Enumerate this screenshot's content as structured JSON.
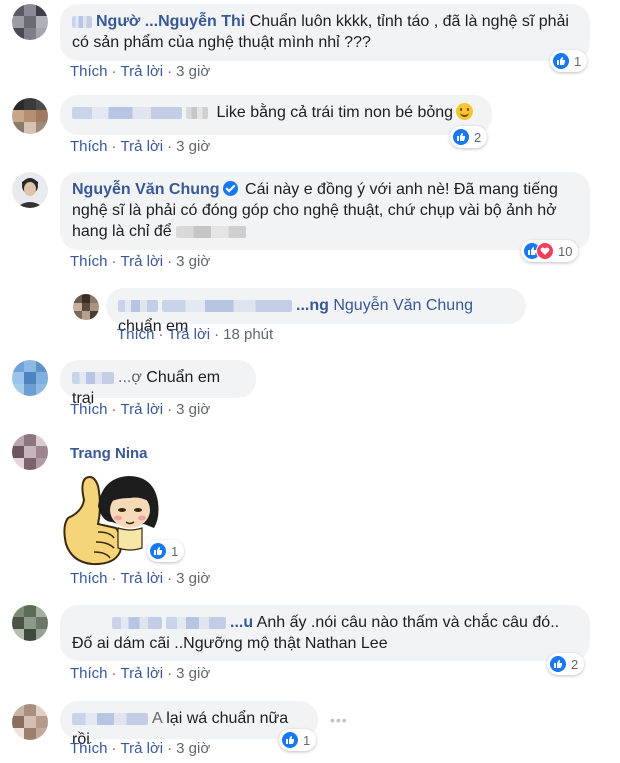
{
  "actions": {
    "like": "Thích",
    "reply": "Trả lời"
  },
  "colors": {
    "link": "#385898",
    "bubble": "#f2f3f5",
    "like": "#1877f2",
    "love": "#f33e58"
  },
  "comments": [
    {
      "author_partial": "Ngườ  ...Nguyễn Thi",
      "text": "Chuẩn luôn kkkk, tỉnh táo , đã là nghệ sĩ phải có sản phẩm của nghệ thuật mình nhỉ ???",
      "time": "3 giờ",
      "reactions": "1"
    },
    {
      "author_partial": "",
      "text": "Like bằng cả trái tim non bé bỏng",
      "time": "3 giờ",
      "reactions": "2"
    },
    {
      "author": "Nguyễn Văn Chung",
      "text": "Cái này e đồng ý với anh nè! Đã mang tiếng nghệ sĩ là phải có đóng góp cho nghệ thuật, chứ chụp vài bộ ảnh hở hang là chỉ để",
      "time": "3 giờ",
      "reactions": "10"
    },
    {
      "author_partial": "...ng",
      "mention": "Nguyễn Văn Chung",
      "text": "chuẩn em",
      "time": "18 phút"
    },
    {
      "author_partial": "...ợ",
      "text": "Chuẩn em trai",
      "time": "3 giờ"
    },
    {
      "author": "Trang Nina",
      "time": "3 giờ",
      "reactions": "1",
      "sticker": "thumbs-up-girl-sticker"
    },
    {
      "author_partial": "...u",
      "text": "Anh ấy .nói câu nào thấm và chắc câu đó.. Đố ai dám cãi ..Ngưỡng mộ thật Nathan Lee",
      "time": "3 giờ",
      "reactions": "2"
    },
    {
      "author_partial": "A",
      "text": "lại wá chuẩn nữa rồi",
      "time": "3 giờ",
      "reactions": "1"
    }
  ]
}
